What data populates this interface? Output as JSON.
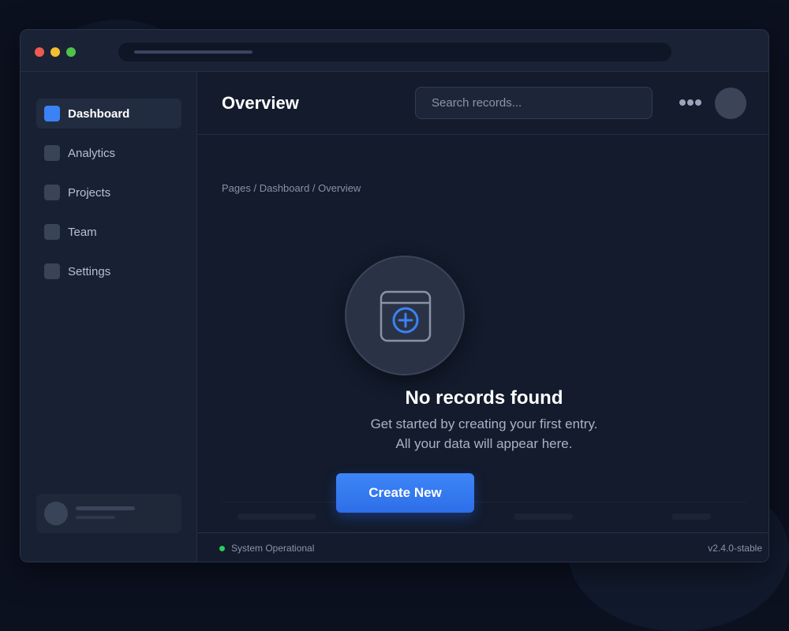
{
  "sidebar": {
    "items": [
      {
        "label": "Dashboard",
        "icon": "dashboard-icon",
        "active": true
      },
      {
        "label": "Analytics",
        "icon": "analytics-icon",
        "active": false
      },
      {
        "label": "Projects",
        "icon": "projects-icon",
        "active": false
      },
      {
        "label": "Team",
        "icon": "team-icon",
        "active": false
      },
      {
        "label": "Settings",
        "icon": "settings-icon",
        "active": false
      }
    ]
  },
  "header": {
    "title": "Overview",
    "search_placeholder": "Search records...",
    "more_icon": "more-dots-icon"
  },
  "breadcrumb": "Pages / Dashboard / Overview",
  "empty_state": {
    "icon": "calendar-add-icon",
    "title": "No records found",
    "line1": "Get started by creating your first entry.",
    "line2": "All your data will appear here.",
    "button_label": "Create New"
  },
  "footer": {
    "status": "System Operational",
    "version": "v2.4.0-stable"
  },
  "colors": {
    "accent": "#3b82f6",
    "status_ok": "#2ecc5a",
    "background": "#0c1120"
  }
}
